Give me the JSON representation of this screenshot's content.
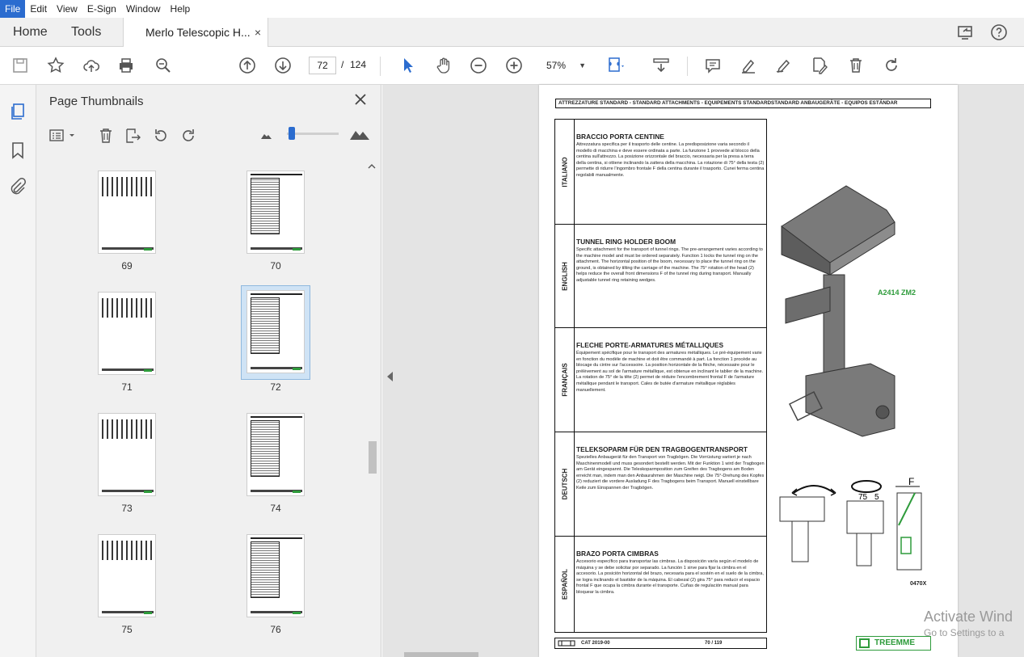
{
  "menu": [
    "File",
    "Edit",
    "View",
    "E-Sign",
    "Window",
    "Help"
  ],
  "tabs": {
    "home": "Home",
    "tools": "Tools",
    "document": "Merlo Telescopic H...",
    "close": "×"
  },
  "toolbar": {
    "page_current": "72",
    "page_sep": "/",
    "page_total": "124",
    "zoom": "57%"
  },
  "thumbnails": {
    "title": "Page Thumbnails",
    "pages": [
      "69",
      "70",
      "71",
      "72",
      "73",
      "74",
      "75",
      "76"
    ],
    "selected": "72"
  },
  "page": {
    "header": "ATTREZZATURE STANDARD - STANDARD ATTACHMENTS - EQUIPEMENTS STANDARDSTANDARD ANBAUGERÄTE - EQUIPOS ESTÁNDAR",
    "sections": [
      {
        "lang": "ITALIANO",
        "title": "BRACCIO PORTA CENTINE",
        "text": "Attrezzatura specifica per il trasporto delle centine. La predisposizione varia secondo il modello di macchina e deve essere ordinata a parte. La funzione 1 provvede al blocco della centina sull'attrezzo. La posizione orizzontale del braccio, necessaria per la presa a terra della centina, si ottiene inclinando la zattera della macchina. La rotazione di 75° della testa (2) permette di ridurre l'ingombro frontale F della centina durante il trasporto. Cunei ferma centina regolabili manualmente."
      },
      {
        "lang": "ENGLISH",
        "title": "TUNNEL RING HOLDER BOOM",
        "text": "Specific attachment for the transport of tunnel rings. The pre-arrangement varies according to the machine model and must be ordered separately. Function 1 locks the tunnel ring on the attachment. The horizontal position of the boom, necessary to place the tunnel ring on the ground, is obtained by tilting the carriage of the machine. The 75° rotation of the head (2) helps reduce the overall front dimensions F of the tunnel ring during transport. Manually adjustable tunnel ring retaining wedges."
      },
      {
        "lang": "FRANÇAIS",
        "title": "FLECHE PORTE-ARMATURES MÉTALLIQUES",
        "text": "Équipement spécifique pour le transport des armatures métalliques. Le pré-équipement varie en fonction du modèle de machine et doit être commandé à part. La fonction 1 procède au blocage du cintre sur l'accessoire. La position horizontale de la flèche, nécessaire pour le prélèvement au sol de l'armature métallique, est obtenue en inclinant le tablier de la machine. La rotation de 75° de la tête (2) permet de réduire l'encombrement frontal F de l'armature métallique pendant le transport. Cales de butée d'armature métallique réglables manuellement."
      },
      {
        "lang": "DEUTSCH",
        "title": "TELEKSOPARM FÜR DEN TRAGBOGENTRANSPORT",
        "text": "Spezielles Anbaugerät für den Transport von Tragbögen. Die Vorrüstung variiert je nach Maschinenmodell und muss gesondert bestellt werden. Mit der Funktion 1 wird der Tragbogen am Gerät eingespannt. Die Teleskoparmposition zum Greifen des Tragbogens am Boden erreicht man, indem man den Anbaurahmen der Maschine neigt. Die 75°-Drehung des Kopfes (2) reduziert die vordere Ausladung F des Tragbogens beim Transport. Manuell einstellbare Keile zum Einspannen der Tragbögen."
      },
      {
        "lang": "ESPAÑOL",
        "title": "BRAZO PORTA CIMBRAS",
        "text": "Accesorio específico para transportar las cimbras. La disposición varía según el modelo de máquina y se debe solicitar por separado. La función 1 sirve para fijar la cimbra en el accesorio. La posición horizontal del brazo, necesaria para el sostén en el suelo de la cimbra, se logra inclinando el bastidor de la máquina. El cabezal (2) gira 75° para reducir el espacio frontal F que ocupa la cimbra durante el transporte. Cuñas de regulación manual para bloquear la cimbra."
      }
    ],
    "code_label": "A2414  ZM2",
    "drawing_code": "0470X",
    "fig_labels": {
      "angle": "75",
      "num": "5",
      "dim": "F"
    },
    "footer_cat": "CAT 2019-00",
    "footer_page": "70 / 119",
    "logo": "TREEMME"
  },
  "watermark": {
    "line1": "Activate Wind",
    "line2": "Go to Settings to a"
  }
}
